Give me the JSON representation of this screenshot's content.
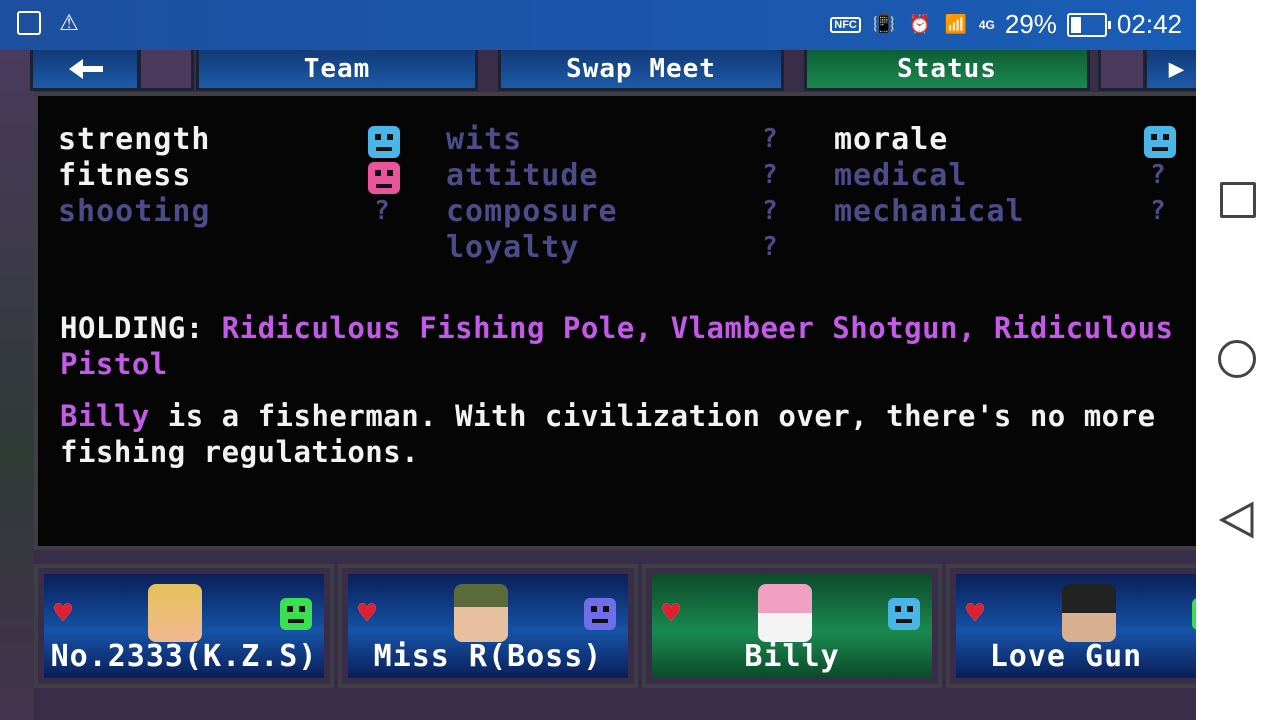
{
  "status_bar": {
    "nfc_label": "NFC",
    "network_label": "4G",
    "battery_percent": "29%",
    "time": "02:42"
  },
  "tabs": [
    {
      "label": "Team",
      "active": false
    },
    {
      "label": "Swap Meet",
      "active": false
    },
    {
      "label": "Status",
      "active": true
    }
  ],
  "stats": {
    "col1": [
      {
        "name": "strength",
        "known": true,
        "mood": "happy",
        "mood_color": "#4ab6e8"
      },
      {
        "name": "fitness",
        "known": true,
        "mood": "sad",
        "mood_color": "#e8559d"
      },
      {
        "name": "shooting",
        "known": false,
        "value": "?"
      }
    ],
    "col2": [
      {
        "name": "wits",
        "known": false,
        "value": "?"
      },
      {
        "name": "attitude",
        "known": false,
        "value": "?"
      },
      {
        "name": "composure",
        "known": false,
        "value": "?"
      },
      {
        "name": "loyalty",
        "known": false,
        "value": "?"
      }
    ],
    "col3": [
      {
        "name": "morale",
        "known": true,
        "mood": "happy",
        "mood_color": "#4ab6e8"
      },
      {
        "name": "medical",
        "known": false,
        "value": "?"
      },
      {
        "name": "mechanical",
        "known": false,
        "value": "?"
      }
    ]
  },
  "holding": {
    "label": "HOLDING:",
    "items_line1": "Ridiculous Fishing Pole, Vlambeer Shotgun, Ridiculous",
    "items_line2": "Pistol"
  },
  "bio": {
    "name": "Billy",
    "text_line1": " is a fisherman. With civilization over, there's no more",
    "text_line2": "fishing regulations."
  },
  "team": [
    {
      "name": "No.2333(K.Z.S)",
      "face_color": "#3be052",
      "selected": false
    },
    {
      "name": "Miss R(Boss)",
      "face_color": "#6f6ee8",
      "selected": false
    },
    {
      "name": "Billy",
      "face_color": "#4ab6e8",
      "selected": true
    },
    {
      "name": "Love Gun",
      "face_color": "#3be052",
      "selected": false
    }
  ],
  "colors": {
    "accent_purple": "#c45ae8",
    "dim_stat": "#4c4c88",
    "tab_active": "#1a8a4f",
    "tab_inactive": "#1c5aa8"
  }
}
